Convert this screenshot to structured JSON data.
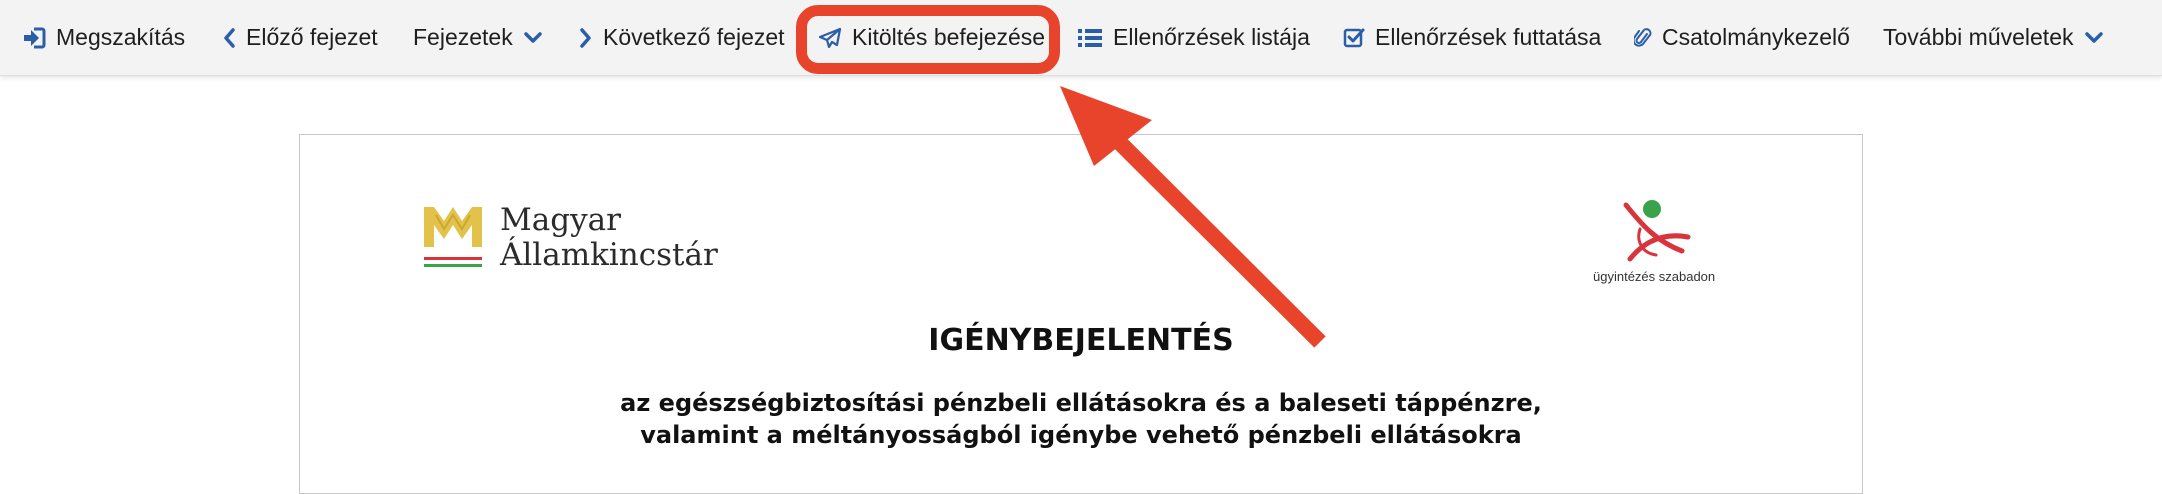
{
  "toolbar": {
    "items": [
      {
        "label": "Megszakítás",
        "icon": "sign-in-icon"
      },
      {
        "label": "Előző fejezet",
        "icon": "chevron-left-icon"
      },
      {
        "label": "Fejezetek",
        "icon": "chevron-down-icon"
      },
      {
        "label": "Következő fejezet",
        "icon": "chevron-right-icon"
      },
      {
        "label": "Kitöltés befejezése",
        "icon": "paper-plane-icon"
      },
      {
        "label": "Ellenőrzések listája",
        "icon": "list-icon"
      },
      {
        "label": "Ellenőrzések futtatása",
        "icon": "checkbox-icon"
      },
      {
        "label": "Csatolmánykezelő",
        "icon": "paperclip-icon"
      },
      {
        "label": "További műveletek",
        "icon": "chevron-down-icon"
      }
    ]
  },
  "annotation": {
    "color": "#e8432b",
    "highlighted_item": "Kitöltés befejezése"
  },
  "document": {
    "logo_left": {
      "line1": "Magyar",
      "line2": "Államkincstár"
    },
    "logo_right": {
      "caption": "ügyintézés szabadon"
    },
    "title": "IGÉNYBEJELENTÉS",
    "subtitle_line1": "az egészségbiztosítási pénzbeli ellátásokra és a baleseti táppénzre,",
    "subtitle_line2": "valamint a méltányosságból igénybe vehető pénzbeli ellátásokra"
  },
  "colors": {
    "accent_blue": "#2b5ea8",
    "toolbar_bg": "#f3f3f3",
    "logo_gold": "#e2c24a",
    "logo_green": "#3aa34a",
    "logo_red": "#d9343b"
  }
}
